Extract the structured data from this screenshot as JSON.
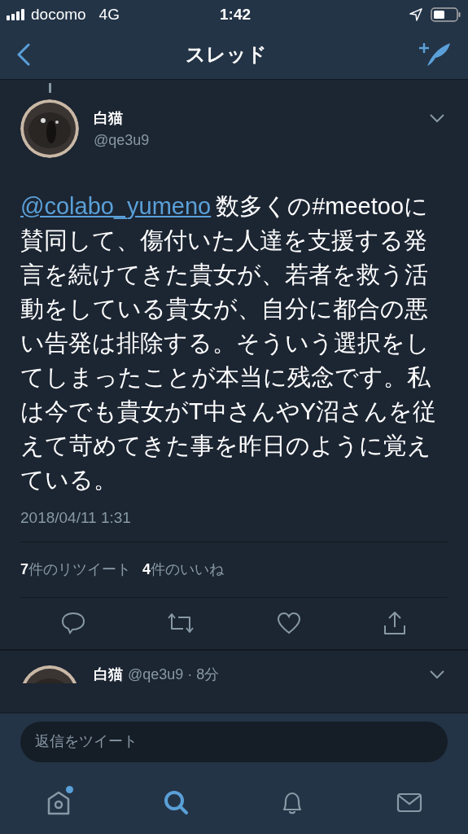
{
  "status_bar": {
    "carrier": "docomo",
    "network": "4G",
    "time": "1:42"
  },
  "nav": {
    "title": "スレッド"
  },
  "tweet": {
    "name": "白猫",
    "handle": "@qe3u9",
    "mention": "@colabo_yumeno",
    "text": "数多くの#meetooに賛同して、傷付いた人達を支援する発言を続けてきた貴女が、若者を救う活動をしている貴女が、自分に都合の悪い告発は排除する。そういう選択をしてしまったことが本当に残念です。私は今でも貴女がT中さんやY沼さんを従えて苛めてきた事を昨日のように覚えている。",
    "timestamp": "2018/04/11 1:31",
    "retweets": {
      "count": "7",
      "label": "件のリツイート"
    },
    "likes": {
      "count": "4",
      "label": "件のいいね"
    }
  },
  "next_tweet": {
    "name": "白猫",
    "meta": "@qe3u9 · 8分"
  },
  "reply": {
    "placeholder": "返信をツイート"
  },
  "tabs": [
    {
      "kind": "home",
      "selected": false,
      "dot": true
    },
    {
      "kind": "search",
      "selected": true,
      "dot": false
    },
    {
      "kind": "notifications",
      "selected": false,
      "dot": false
    },
    {
      "kind": "messages",
      "selected": false,
      "dot": false
    }
  ]
}
